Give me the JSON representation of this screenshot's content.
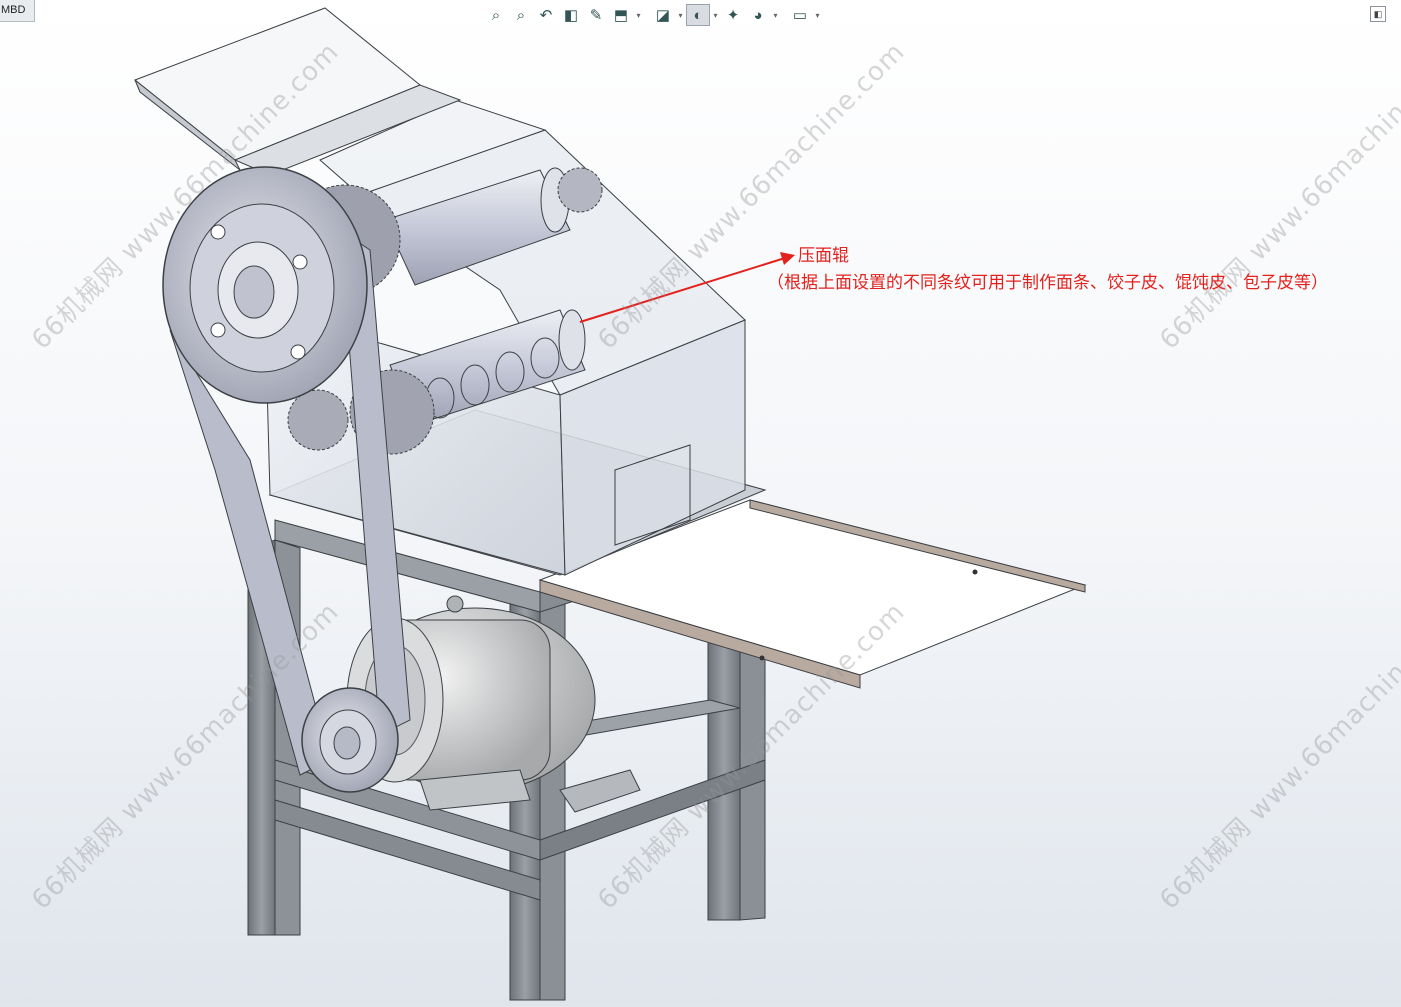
{
  "app": {
    "corner_tab": "MBD"
  },
  "toolbar": {
    "buttons": [
      {
        "icon": "zoom-to-fit-icon",
        "glyph": "⌕"
      },
      {
        "icon": "zoom-to-area-icon",
        "glyph": "⌕"
      },
      {
        "icon": "previous-view-icon",
        "glyph": "↶"
      },
      {
        "icon": "section-view-icon",
        "glyph": "◧"
      },
      {
        "icon": "dynamic-annotation-icon",
        "glyph": "✎"
      },
      {
        "icon": "view-orientation-icon",
        "glyph": "⬒"
      },
      {
        "icon": "display-style-icon",
        "glyph": "◪"
      },
      {
        "icon": "hide-show-items-icon",
        "glyph": "◐"
      },
      {
        "icon": "edit-appearance-icon",
        "glyph": "✦"
      },
      {
        "icon": "apply-scene-icon",
        "glyph": "◕"
      },
      {
        "icon": "view-settings-icon",
        "glyph": "▭"
      }
    ],
    "panel_toggle_icon": "panel-toggle-icon"
  },
  "annotation": {
    "title": "压面辊",
    "description": "（根据上面设置的不同条纹可用于制作面条、饺子皮、馄饨皮、包子皮等）",
    "color": "#e3211d"
  },
  "watermark": {
    "text": "66机械网 www.66machine.com"
  },
  "colors": {
    "frame": "#7d8388",
    "hopper_glass": "#d7dde6",
    "belt": "#b9bccb",
    "tray_edge": "#b9aaa0"
  }
}
